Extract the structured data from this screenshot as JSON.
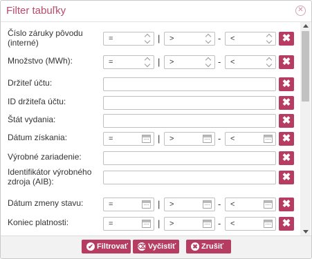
{
  "dialog": {
    "title": "Filter tabuľky",
    "close_icon": "close-circle-icon"
  },
  "filters": [
    {
      "label": "Číslo záruky pôvodu (interné)",
      "type": "range-number",
      "op": "=",
      "from": ">",
      "to": "<"
    },
    {
      "label": "Množstvo (MWh):",
      "type": "range-number",
      "op": "=",
      "from": ">",
      "to": "<"
    },
    {
      "label": "Držiteľ účtu:",
      "type": "text",
      "value": ""
    },
    {
      "label": "ID držiteľa účtu:",
      "type": "text",
      "value": ""
    },
    {
      "label": "Štát vydania:",
      "type": "text",
      "value": ""
    },
    {
      "label": "Dátum získania:",
      "type": "range-date",
      "op": "=",
      "from": ">",
      "to": "<"
    },
    {
      "label": "Výrobné zariadenie:",
      "type": "text",
      "value": ""
    },
    {
      "label": "Identifikátor výrobného zdroja (AIB):",
      "type": "text",
      "value": ""
    },
    {
      "label": "Dátum zmeny stavu:",
      "type": "range-date",
      "op": "=",
      "from": ">",
      "to": "<"
    },
    {
      "label": "Koniec platnosti:",
      "type": "range-date",
      "op": "=",
      "from": ">",
      "to": "<"
    }
  ],
  "separators": {
    "pipe": "|",
    "dash": "-"
  },
  "delete_glyph": "✖",
  "footer": {
    "filter_label": "Filtrovať",
    "clear_label": "Vyčistiť",
    "cancel_label": "Zrušiť"
  },
  "colors": {
    "accent": "#b63c61",
    "title": "#b84a6a"
  }
}
